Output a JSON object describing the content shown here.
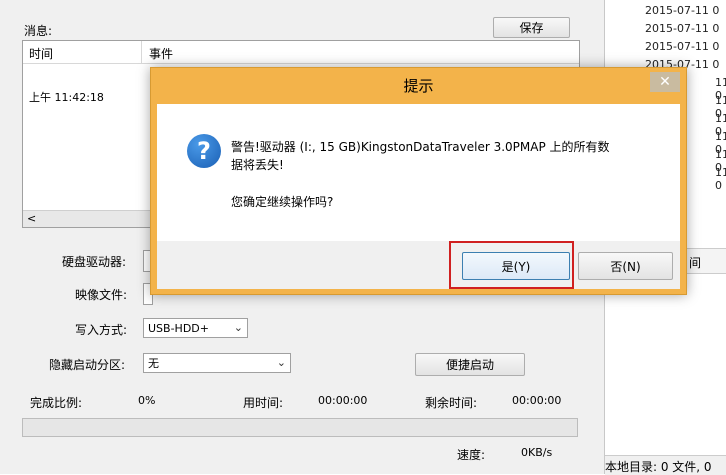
{
  "app": {
    "messages_label": "消息:",
    "save_button": "保存",
    "columns": [
      "时间",
      "事件"
    ],
    "log_row": {
      "time": "上午 11:42:18"
    },
    "scroll_left": "<",
    "drive_label": "硬盘驱动器:",
    "image_label": "映像文件:",
    "write_mode_label": "写入方式:",
    "write_mode_value": "USB-HDD+",
    "hide_partition_label": "隐藏启动分区:",
    "hide_partition_value": "无",
    "quick_boot_button": "便捷启动",
    "progress_label": "完成比例:",
    "progress_value": "0%",
    "elapsed_label": "用时间:",
    "elapsed_value": "00:00:00",
    "remaining_label": "剩余时间:",
    "remaining_value": "00:00:00",
    "speed_label": "速度:",
    "speed_value": "0KB/s",
    "progress_fraction": 0
  },
  "right_panel": {
    "dates": [
      "2015-07-11 0",
      "2015-07-11 0",
      "2015-07-11 0",
      "2015-07-11 0"
    ],
    "fragments": [
      "11 0",
      "11 0",
      "11 0",
      "11 0",
      "11 0",
      "11 0"
    ],
    "col_label": "间",
    "footer": "本地目录: 0 文件, 0"
  },
  "dialog": {
    "title": "提示",
    "close": "✕",
    "message_line1": "警告!驱动器 (I:, 15 GB)KingstonDataTraveler 3.0PMAP 上的所有数",
    "message_line2": "据将丢失!",
    "confirm_question": "您确定继续操作吗?",
    "yes_button": "是(Y)",
    "no_button": "否(N)"
  }
}
